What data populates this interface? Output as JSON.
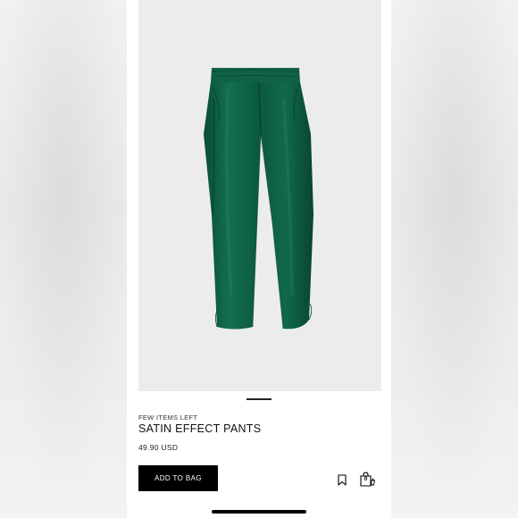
{
  "product": {
    "stock_note": "FEW ITEMS LEFT",
    "title": "SATIN EFFECT PANTS",
    "price": "49.90 USD",
    "color": "#0d5c45",
    "image_background": "#ececec"
  },
  "actions": {
    "add_to_bag_label": "ADD TO BAG",
    "bookmark_icon": "bookmark-icon",
    "bag_icon": "shopping-bag-icon",
    "bag_count": "0"
  },
  "gallery": {
    "active_index": 1,
    "total": 1
  }
}
